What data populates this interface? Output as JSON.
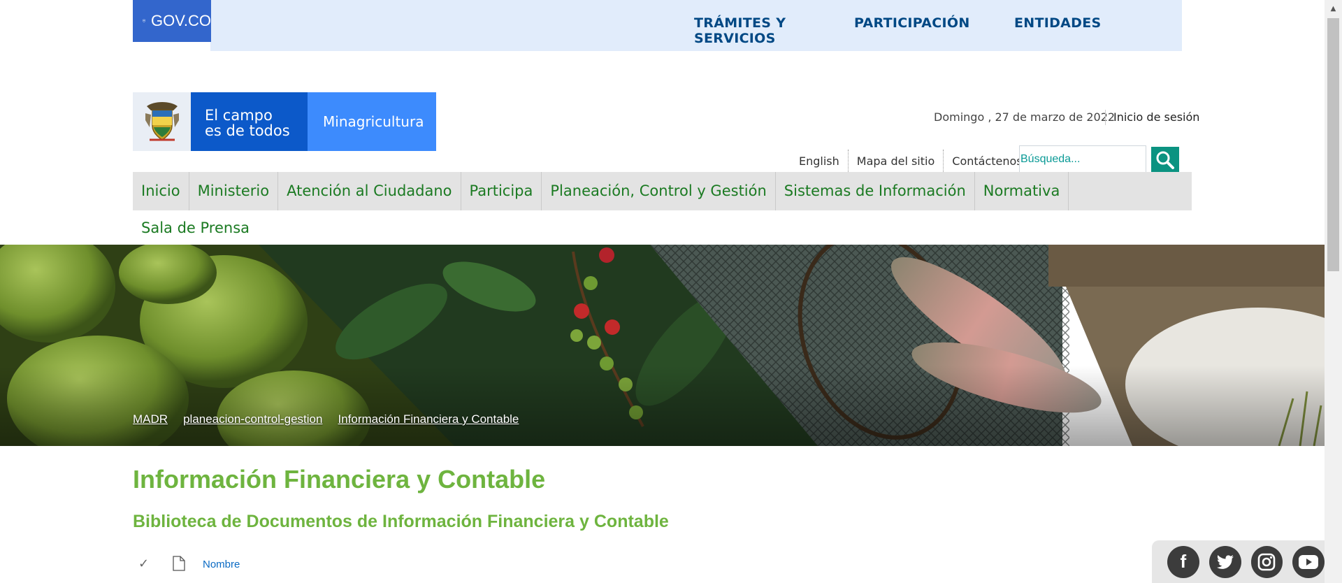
{
  "gov_bar": {
    "badge_label": "GOV.CO",
    "links": [
      "TRÁMITES Y SERVICIOS",
      "PARTICIPACIÓN",
      "ENTIDADES"
    ]
  },
  "header": {
    "logo_line1": "El campo",
    "logo_line2": "es de todos",
    "logo_ministry": "Minagricultura",
    "date": "Domingo , 27 de marzo de 2022",
    "login": "Inicio de sesión",
    "util_links": [
      "English",
      "Mapa del sitio",
      "Contáctenos"
    ],
    "search_placeholder": "Búsqueda..."
  },
  "nav": {
    "items": [
      "Inicio",
      "Ministerio",
      "Atención al Ciudadano",
      "Participa",
      "Planeación, Control y Gestión",
      "Sistemas de Información",
      "Normativa"
    ],
    "second_row": "Sala de Prensa"
  },
  "breadcrumb": [
    "MADR",
    "planeacion-control-gestion",
    "Información Financiera y Contable"
  ],
  "main": {
    "title": "Información Financiera y Contable",
    "subtitle": "Biblioteca de Documentos de Información Financiera y Contable",
    "column_name": "Nombre"
  },
  "social": {
    "icons": [
      "facebook-icon",
      "twitter-icon",
      "instagram-icon",
      "youtube-icon"
    ],
    "glyphs": [
      "f",
      "t",
      "◎",
      "▶"
    ]
  },
  "colors": {
    "gov_blue": "#3366cc",
    "gov_bar_bg": "#e1ecfb",
    "nav_green": "#1b7a22",
    "title_green": "#6eb43f",
    "search_button": "#0b9381"
  }
}
